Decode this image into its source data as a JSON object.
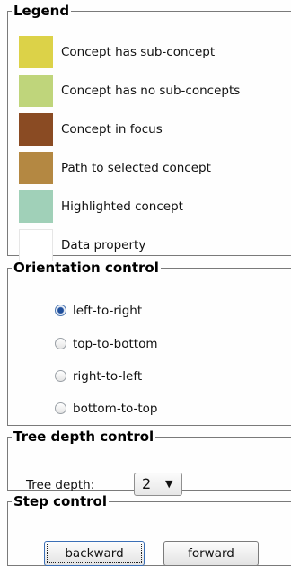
{
  "legend": {
    "title": "Legend",
    "items": [
      {
        "label": "Concept has sub-concept",
        "color": "#dcd248"
      },
      {
        "label": "Concept has no sub-concepts",
        "color": "#bfd57b"
      },
      {
        "label": "Concept in focus",
        "color": "#8a4b23"
      },
      {
        "label": "Path to selected concept",
        "color": "#b48842"
      },
      {
        "label": "Highlighted concept",
        "color": "#a0d0b8"
      },
      {
        "label": "Data property",
        "color": "#ffffff"
      }
    ]
  },
  "orientation": {
    "title": "Orientation control",
    "options": [
      "left-to-right",
      "top-to-bottom",
      "right-to-left",
      "bottom-to-top"
    ],
    "selected": "left-to-right"
  },
  "depth": {
    "title": "Tree depth control",
    "label": "Tree depth:",
    "value": "2"
  },
  "step": {
    "title": "Step control",
    "backward_label": "backward",
    "forward_label": "forward"
  }
}
